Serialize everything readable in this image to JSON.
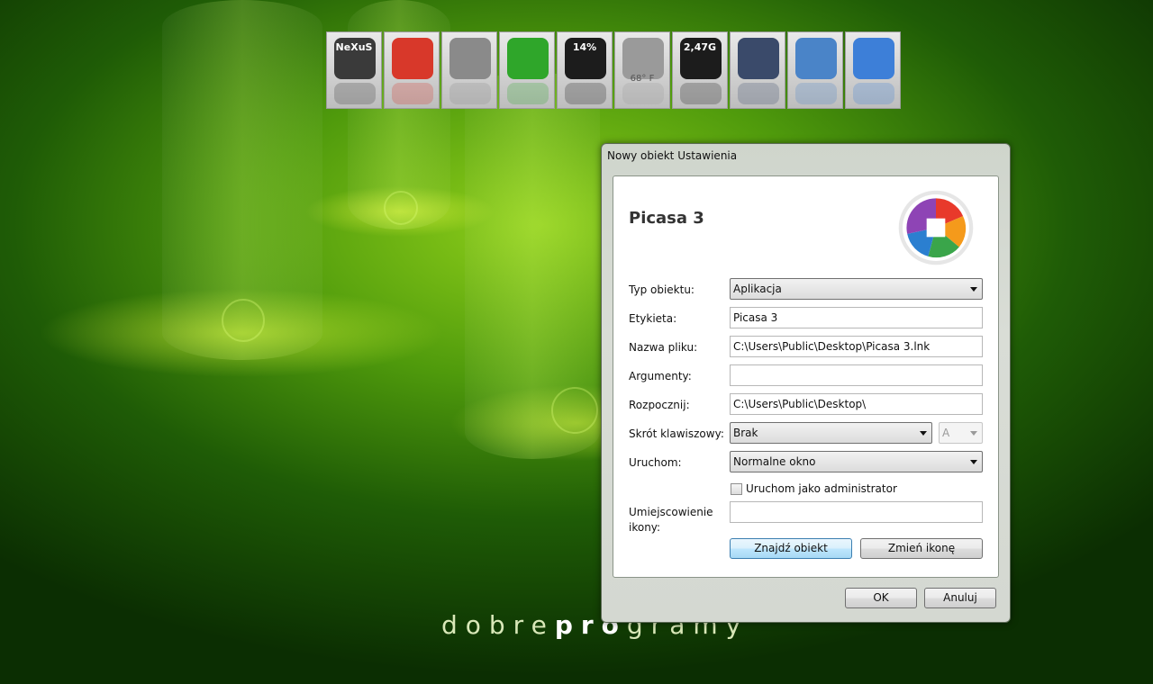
{
  "desktop": {
    "brand_light": "dobre",
    "brand_bold": "pro",
    "brand_rest": "gramy"
  },
  "dock": {
    "items": [
      {
        "name": "nexus-icon",
        "label": "NeXuS",
        "color": "#3a3a3a"
      },
      {
        "name": "windows-logo-icon",
        "label": "",
        "color": "#d8382a"
      },
      {
        "name": "clock-icon",
        "label": "",
        "color": "#8a8a8a"
      },
      {
        "name": "recycle-bin-icon",
        "label": "",
        "color": "#2fa62a"
      },
      {
        "name": "cpu-monitor-icon",
        "label": "14%",
        "color": "#1c1c1c"
      },
      {
        "name": "weather-icon",
        "label": "",
        "sublabel": "68° F",
        "color": "#9a9a9a"
      },
      {
        "name": "memory-monitor-icon",
        "label": "2,47G",
        "color": "#1c1c1c"
      },
      {
        "name": "globe-icon",
        "label": "",
        "color": "#3a4a6a"
      },
      {
        "name": "mail-icon",
        "label": "",
        "color": "#4a84c8"
      },
      {
        "name": "photo-camera-icon",
        "label": "",
        "color": "#3d7fd8"
      }
    ]
  },
  "dialog": {
    "title": "Nowy obiekt Ustawienia",
    "app_name": "Picasa 3",
    "fields": {
      "type_label": "Typ obiektu:",
      "type_value": "Aplikacja",
      "label_label": "Etykieta:",
      "label_value": "Picasa 3",
      "file_label": "Nazwa pliku:",
      "file_value": "C:\\Users\\Public\\Desktop\\Picasa 3.lnk",
      "args_label": "Argumenty:",
      "args_value": "",
      "start_label": "Rozpocznij:",
      "start_value": "C:\\Users\\Public\\Desktop\\",
      "shortcut_label": "Skrót klawiszowy:",
      "shortcut_value": "Brak",
      "shortcut_key": "A",
      "run_label": "Uruchom:",
      "run_value": "Normalne okno",
      "admin_label": "Uruchom jako administrator",
      "icon_location_label_1": "Umiejscowienie",
      "icon_location_label_2": "ikony:",
      "icon_location_value": ""
    },
    "buttons": {
      "find_target": "Znajdź obiekt",
      "change_icon": "Zmień ikonę",
      "ok": "OK",
      "cancel": "Anuluj"
    }
  }
}
